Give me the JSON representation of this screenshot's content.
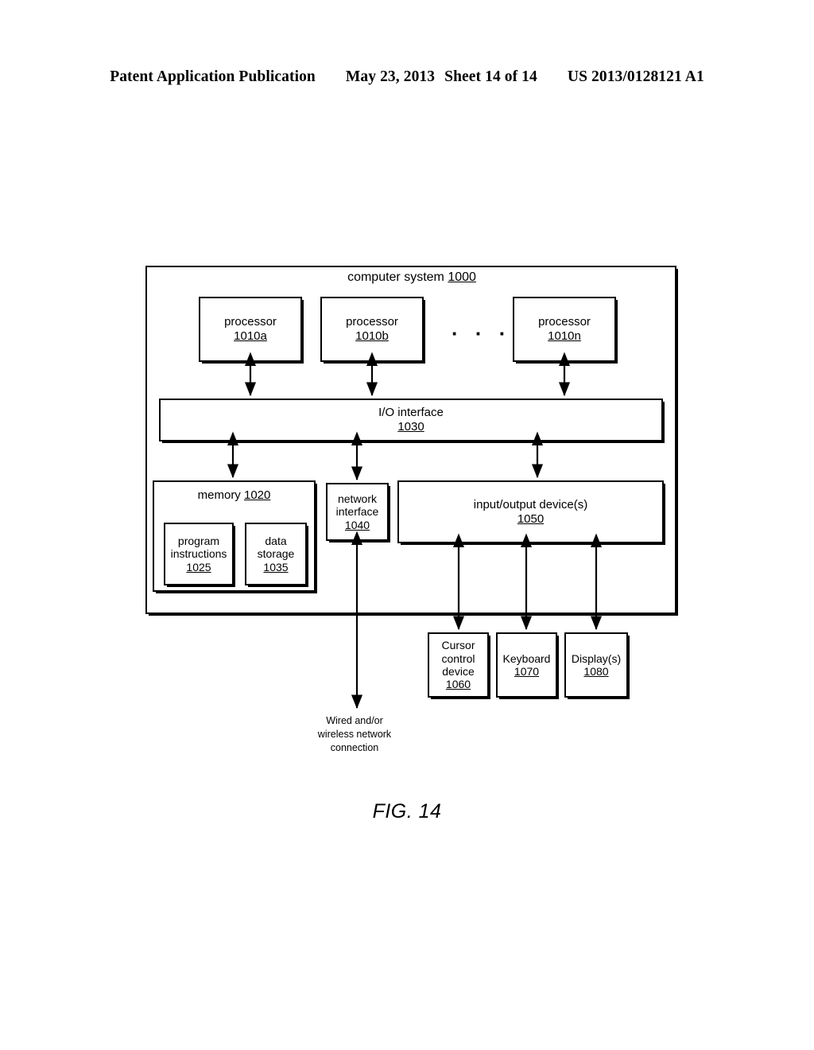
{
  "page_header": {
    "publication": "Patent Application Publication",
    "date": "May 23, 2013",
    "sheet": "Sheet 14 of 14",
    "patent_number": "US 2013/0128121 A1"
  },
  "figure": {
    "caption": "FIG. 14",
    "system": {
      "title": "computer system",
      "number": "1000"
    },
    "processors": [
      {
        "label": "processor",
        "number": "1010a"
      },
      {
        "label": "processor",
        "number": "1010b"
      },
      {
        "label": "processor",
        "number": "1010n"
      }
    ],
    "processor_ellipsis": "· · ·",
    "io_interface": {
      "label": "I/O interface",
      "number": "1030"
    },
    "memory": {
      "label": "memory",
      "number": "1020",
      "blocks": [
        {
          "label_line1": "program",
          "label_line2": "instructions",
          "number": "1025"
        },
        {
          "label_line1": "data",
          "label_line2": "storage",
          "number": "1035"
        }
      ]
    },
    "network_interface": {
      "label_line1": "network",
      "label_line2": "interface",
      "number": "1040"
    },
    "io_devices": {
      "label": "input/output device(s)",
      "number": "1050"
    },
    "peripherals": [
      {
        "label_line1": "Cursor",
        "label_line2": "control",
        "label_line3": "device",
        "number": "1060"
      },
      {
        "label_line1": "Keyboard",
        "label_line2": "",
        "label_line3": "",
        "number": "1070"
      },
      {
        "label_line1": "Display(s)",
        "label_line2": "",
        "label_line3": "",
        "number": "1080"
      }
    ],
    "network_connection_caption": {
      "line1": "Wired and/or",
      "line2": "wireless network",
      "line3": "connection"
    }
  },
  "colors": {
    "ink": "#000000",
    "paper": "#ffffff"
  }
}
